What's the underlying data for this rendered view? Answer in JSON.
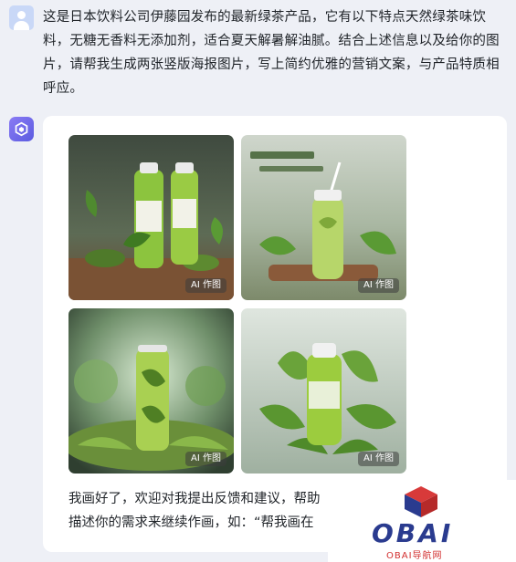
{
  "user": {
    "avatar": "user-avatar",
    "message": "这是日本饮料公司伊藤园发布的最新绿茶产品，它有以下特点天然绿茶味饮料，无糖无香料无添加剂，适合夏天解暑解油腻。结合上述信息以及给你的图片，请帮我生成两张竖版海报图片，写上简约优雅的营销文案，与产品特质相呼应。"
  },
  "bot": {
    "avatar": "bot-logo",
    "images": [
      {
        "badge": "AI 作图",
        "scene": "two green tea bottles on wooden table with leaves"
      },
      {
        "badge": "AI 作图",
        "scene": "green tea bottle with straw on tray with leaves"
      },
      {
        "badge": "AI 作图",
        "scene": "green tea can with tea granules and leaves"
      },
      {
        "badge": "AI 作图",
        "scene": "green tea bottle surrounded by fresh leaves"
      }
    ],
    "reply_line1": "我画好了，欢迎对我提出反馈和建议，帮助",
    "reply_line2": "描述你的需求来继续作画，如：“帮我画在"
  },
  "watermark": {
    "word": "OBAI",
    "sub": "OBAI导航网"
  },
  "colors": {
    "background": "#eef0f6",
    "card": "#ffffff",
    "bot_accent": "#6b63ea",
    "watermark_blue": "#2a3b8f",
    "watermark_red": "#d22f2f"
  }
}
